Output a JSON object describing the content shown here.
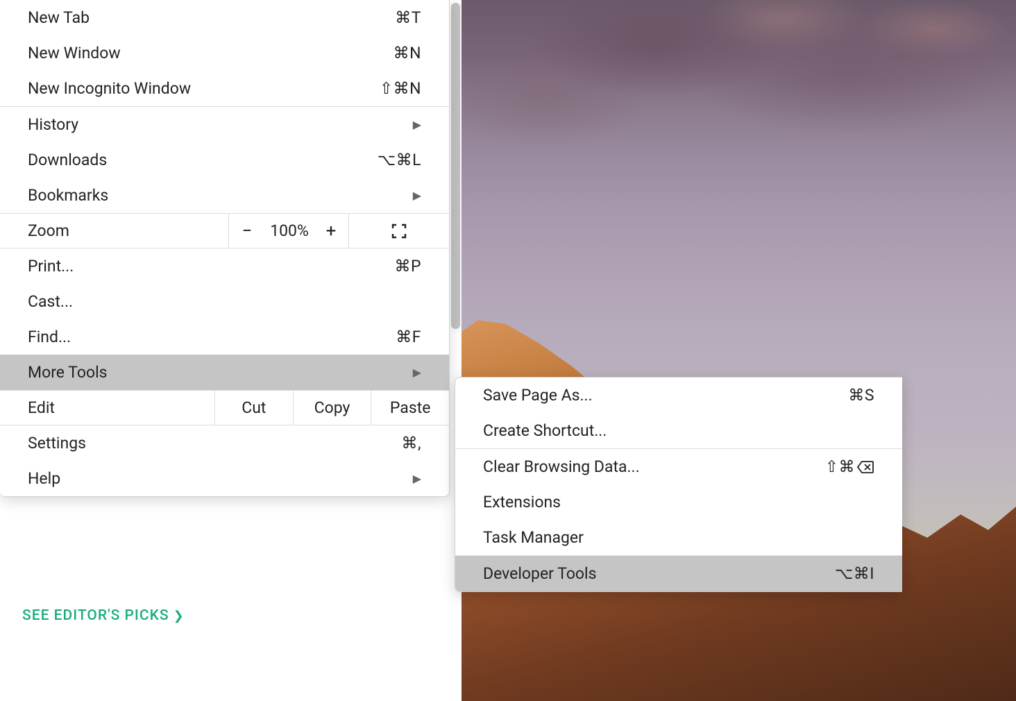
{
  "menu": {
    "new_tab": {
      "label": "New Tab",
      "shortcut": "⌘T"
    },
    "new_window": {
      "label": "New Window",
      "shortcut": "⌘N"
    },
    "new_incognito": {
      "label": "New Incognito Window",
      "shortcut": "⇧⌘N"
    },
    "history": {
      "label": "History"
    },
    "downloads": {
      "label": "Downloads",
      "shortcut": "⌥⌘L"
    },
    "bookmarks": {
      "label": "Bookmarks"
    },
    "zoom": {
      "label": "Zoom",
      "value": "100%",
      "minus": "−",
      "plus": "+"
    },
    "print": {
      "label": "Print...",
      "shortcut": "⌘P"
    },
    "cast": {
      "label": "Cast..."
    },
    "find": {
      "label": "Find...",
      "shortcut": "⌘F"
    },
    "more_tools": {
      "label": "More Tools"
    },
    "edit": {
      "label": "Edit",
      "cut": "Cut",
      "copy": "Copy",
      "paste": "Paste"
    },
    "settings": {
      "label": "Settings",
      "shortcut": "⌘,"
    },
    "help": {
      "label": "Help"
    }
  },
  "submenu": {
    "save_page": {
      "label": "Save Page As...",
      "shortcut": "⌘S"
    },
    "create_shortcut": {
      "label": "Create Shortcut..."
    },
    "clear_data": {
      "label": "Clear Browsing Data...",
      "shortcut_prefix": "⇧⌘"
    },
    "extensions": {
      "label": "Extensions"
    },
    "task_manager": {
      "label": "Task Manager"
    },
    "dev_tools": {
      "label": "Developer Tools",
      "shortcut": "⌥⌘I"
    }
  },
  "page": {
    "editors_picks": "SEE EDITOR'S PICKS"
  }
}
